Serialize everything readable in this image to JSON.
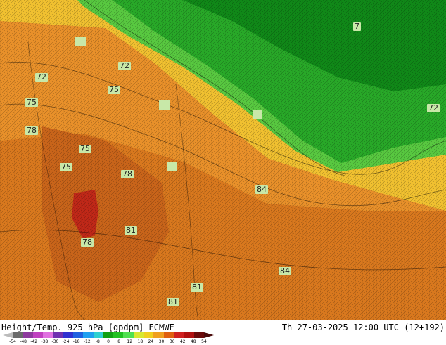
{
  "map": {
    "contour_labels": [
      "7",
      "72",
      "72",
      "75",
      "75",
      "72",
      "78",
      "75",
      "75",
      "78",
      "84",
      "81",
      "78",
      "84",
      "81",
      "81"
    ]
  },
  "footer": {
    "title": "Height/Temp. 925 hPa [gpdpm] ECMWF",
    "valid": "Th 27-03-2025 12:00 UTC (12+192)",
    "scale_ticks": [
      "-54",
      "-48",
      "-42",
      "-38",
      "-30",
      "-24",
      "-18",
      "-12",
      "-8",
      "0",
      "8",
      "12",
      "18",
      "24",
      "30",
      "36",
      "42",
      "48",
      "54"
    ],
    "scale_colors": [
      "#6a6a6a",
      "#8e3a9e",
      "#c040c0",
      "#e070e0",
      "#7030b0",
      "#3030d0",
      "#2060e0",
      "#20a0f0",
      "#30d0d0",
      "#10a010",
      "#20c020",
      "#50e050",
      "#d8e830",
      "#f0d020",
      "#f0a020",
      "#e06010",
      "#d02020",
      "#b01010",
      "#6a0a0a"
    ]
  }
}
